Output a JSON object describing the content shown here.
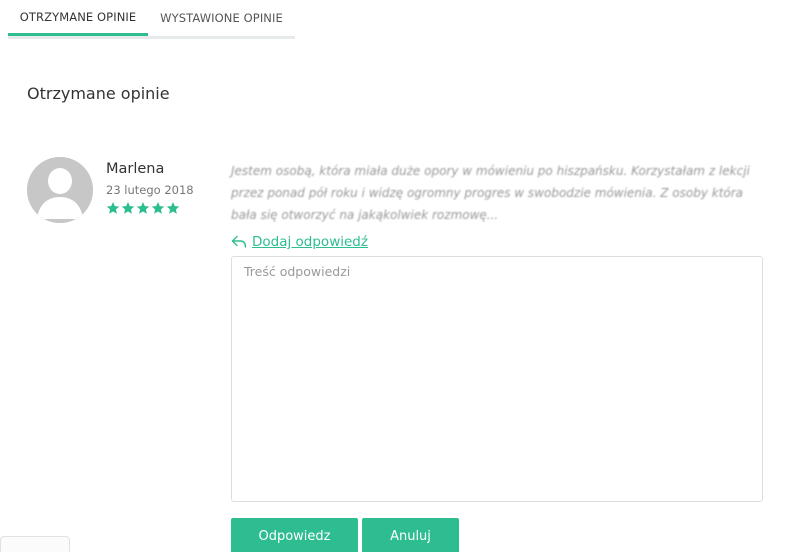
{
  "tabs": [
    {
      "label": "OTRZYMANE OPINIE",
      "active": true
    },
    {
      "label": "WYSTAWIONE OPINIE",
      "active": false
    }
  ],
  "section": {
    "title": "Otrzymane opinie"
  },
  "review": {
    "author": "Marlena",
    "date": "23 lutego 2018",
    "rating": 5,
    "rating_max": 5,
    "text": "Jestem osobą, która miała duże opory w mówieniu po hiszpańsku. Korzystałam z lekcji przez ponad pół roku i widzę ogromny progres w swobodzie mówienia. Z osoby która bała się otworzyć na jakąkolwiek rozmowę..."
  },
  "reply": {
    "link_label": "Dodaj odpowiedź",
    "placeholder": "Treść odpowiedzi",
    "value": ""
  },
  "buttons": {
    "submit_label": "Odpowiedz",
    "cancel_label": "Anuluj"
  },
  "colors": {
    "accent": "#2dbd91",
    "avatar_bg": "#c7c7c7",
    "tab_underline": "#e6eaea"
  },
  "icons": {
    "reply": "reply-arrow-icon",
    "star": "star-icon",
    "avatar": "user-silhouette-icon"
  }
}
